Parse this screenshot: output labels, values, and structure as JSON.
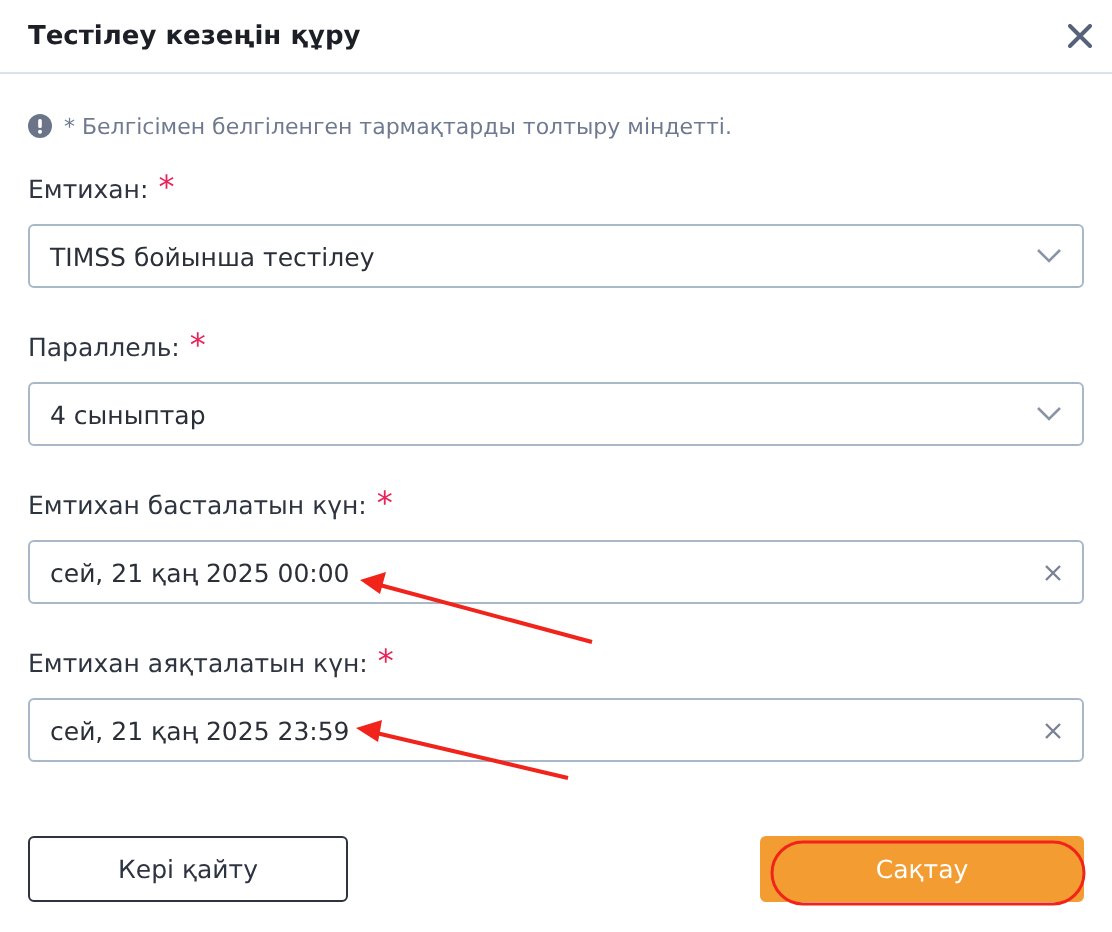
{
  "dialog": {
    "title": "Тестілеу кезеңін құру",
    "note": "* Белгісімен белгіленген тармақтарды толтыру міндетті.",
    "fields": [
      {
        "kind": "select",
        "label": "Емтихан:",
        "required_mark": "*",
        "value": "TIMSS бойынша тестілеу"
      },
      {
        "kind": "select",
        "label": "Параллель:",
        "required_mark": "*",
        "value": "4 сыныптар"
      },
      {
        "kind": "date",
        "label": "Емтихан басталатын күн:",
        "required_mark": "*",
        "value": "сей, 21 қаң 2025 00:00"
      },
      {
        "kind": "date",
        "label": "Емтихан аяқталатын күн:",
        "required_mark": "*",
        "value": "сей, 21 қаң 2025 23:59"
      }
    ],
    "buttons": [
      {
        "kind": "secondary",
        "label": "Кері қайту"
      },
      {
        "kind": "primary",
        "label": "Сақтау"
      }
    ]
  }
}
